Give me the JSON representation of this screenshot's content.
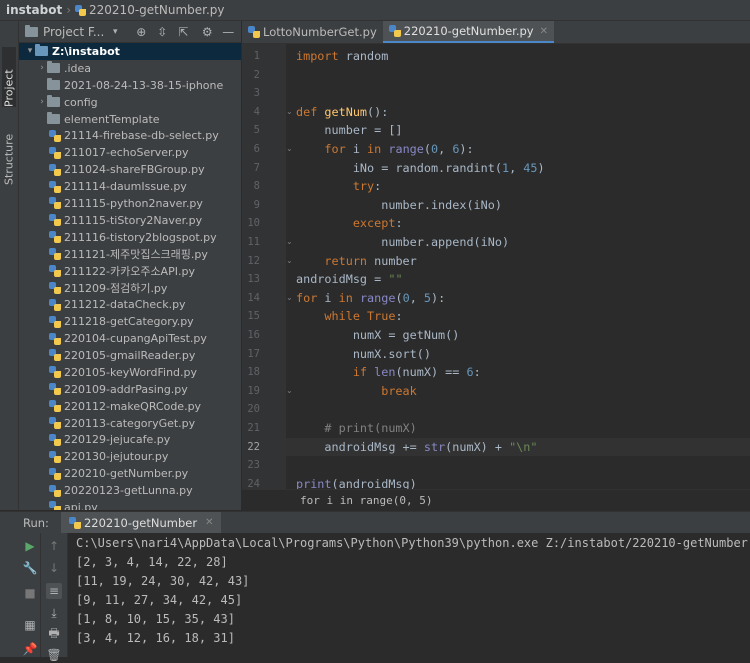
{
  "titlebar": {
    "project": "instabot",
    "file": "220210-getNumber.py"
  },
  "tool_windows": {
    "project": "Project",
    "structure": "Structure"
  },
  "project_panel": {
    "header_label": "Project F...",
    "root": "Z:\\instabot",
    "items": [
      {
        "name": ".idea",
        "type": "folder",
        "expandable": true
      },
      {
        "name": "2021-08-24-13-38-15-iphone",
        "type": "folder",
        "expandable": false
      },
      {
        "name": "config",
        "type": "folder",
        "expandable": true
      },
      {
        "name": "elementTemplate",
        "type": "folder",
        "expandable": false
      },
      {
        "name": "21114-firebase-db-select.py",
        "type": "py"
      },
      {
        "name": "211017-echoServer.py",
        "type": "py"
      },
      {
        "name": "211024-shareFBGroup.py",
        "type": "py"
      },
      {
        "name": "211114-daumIssue.py",
        "type": "py"
      },
      {
        "name": "211115-python2naver.py",
        "type": "py"
      },
      {
        "name": "211115-tiStory2Naver.py",
        "type": "py"
      },
      {
        "name": "211116-tistory2blogspot.py",
        "type": "py"
      },
      {
        "name": "211121-제주맛집스크래핑.py",
        "type": "py"
      },
      {
        "name": "211122-카카오주소API.py",
        "type": "py"
      },
      {
        "name": "211209-점검하기.py",
        "type": "py"
      },
      {
        "name": "211212-dataCheck.py",
        "type": "py"
      },
      {
        "name": "211218-getCategory.py",
        "type": "py"
      },
      {
        "name": "220104-cupangApiTest.py",
        "type": "py"
      },
      {
        "name": "220105-gmailReader.py",
        "type": "py"
      },
      {
        "name": "220105-keyWordFind.py",
        "type": "py"
      },
      {
        "name": "220109-addrPasing.py",
        "type": "py"
      },
      {
        "name": "220112-makeQRCode.py",
        "type": "py"
      },
      {
        "name": "220113-categoryGet.py",
        "type": "py"
      },
      {
        "name": "220129-jejucafe.py",
        "type": "py"
      },
      {
        "name": "220130-jejutour.py",
        "type": "py"
      },
      {
        "name": "220210-getNumber.py",
        "type": "py"
      },
      {
        "name": "20220123-getLunna.py",
        "type": "py"
      },
      {
        "name": "api.py",
        "type": "py"
      }
    ]
  },
  "editor": {
    "tabs": [
      {
        "label": "LottoNumberGet.py",
        "active": false
      },
      {
        "label": "220210-getNumber.py",
        "active": true
      }
    ],
    "current_line": 22,
    "lines": [
      {
        "n": 1,
        "tokens": [
          [
            "kw",
            "import"
          ],
          [
            "p",
            " random"
          ]
        ]
      },
      {
        "n": 2,
        "tokens": []
      },
      {
        "n": 3,
        "tokens": []
      },
      {
        "n": 4,
        "tokens": [
          [
            "kw",
            "def "
          ],
          [
            "fn",
            "getNum"
          ],
          [
            "p",
            "():"
          ]
        ]
      },
      {
        "n": 5,
        "tokens": [
          [
            "p",
            "    number = []"
          ]
        ]
      },
      {
        "n": 6,
        "tokens": [
          [
            "kw",
            "    for "
          ],
          [
            "p",
            "i "
          ],
          [
            "kw",
            "in "
          ],
          [
            "bi",
            "range"
          ],
          [
            "p",
            "("
          ],
          [
            "num",
            "0"
          ],
          [
            "p",
            ", "
          ],
          [
            "num",
            "6"
          ],
          [
            "p",
            "):"
          ]
        ]
      },
      {
        "n": 7,
        "tokens": [
          [
            "p",
            "        iNo = random.randint("
          ],
          [
            "num",
            "1"
          ],
          [
            "p",
            ", "
          ],
          [
            "num",
            "45"
          ],
          [
            "p",
            ")"
          ]
        ]
      },
      {
        "n": 8,
        "tokens": [
          [
            "kw",
            "        try"
          ],
          [
            "p",
            ":"
          ]
        ]
      },
      {
        "n": 9,
        "tokens": [
          [
            "p",
            "            number.index(iNo)"
          ]
        ]
      },
      {
        "n": 10,
        "tokens": [
          [
            "kw",
            "        except"
          ],
          [
            "p",
            ":"
          ]
        ]
      },
      {
        "n": 11,
        "tokens": [
          [
            "p",
            "            number.append(iNo)"
          ]
        ]
      },
      {
        "n": 12,
        "tokens": [
          [
            "kw",
            "    return "
          ],
          [
            "p",
            "number"
          ]
        ]
      },
      {
        "n": 13,
        "tokens": [
          [
            "p",
            "androidMsg = "
          ],
          [
            "str",
            "\"\""
          ]
        ]
      },
      {
        "n": 14,
        "tokens": [
          [
            "kw",
            "for "
          ],
          [
            "p",
            "i "
          ],
          [
            "kw",
            "in "
          ],
          [
            "bi",
            "range"
          ],
          [
            "p",
            "("
          ],
          [
            "num",
            "0"
          ],
          [
            "p",
            ", "
          ],
          [
            "num",
            "5"
          ],
          [
            "p",
            "):"
          ]
        ]
      },
      {
        "n": 15,
        "tokens": [
          [
            "kw",
            "    while True"
          ],
          [
            "p",
            ":"
          ]
        ]
      },
      {
        "n": 16,
        "tokens": [
          [
            "p",
            "        numX = getNum()"
          ]
        ]
      },
      {
        "n": 17,
        "tokens": [
          [
            "p",
            "        numX.sort()"
          ]
        ]
      },
      {
        "n": 18,
        "tokens": [
          [
            "kw",
            "        if "
          ],
          [
            "bi",
            "len"
          ],
          [
            "p",
            "(numX) == "
          ],
          [
            "num",
            "6"
          ],
          [
            "p",
            ":"
          ]
        ]
      },
      {
        "n": 19,
        "tokens": [
          [
            "kw",
            "            break"
          ]
        ]
      },
      {
        "n": 20,
        "tokens": []
      },
      {
        "n": 21,
        "tokens": [
          [
            "cm",
            "    # print(numX)"
          ]
        ]
      },
      {
        "n": 22,
        "tokens": [
          [
            "p",
            "    androidMsg += "
          ],
          [
            "bi",
            "str"
          ],
          [
            "p",
            "(numX) + "
          ],
          [
            "str",
            "\"\\n\""
          ]
        ]
      },
      {
        "n": 23,
        "tokens": []
      },
      {
        "n": 24,
        "tokens": [
          [
            "bi",
            "print"
          ],
          [
            "p",
            "(androidMsg)"
          ]
        ]
      }
    ],
    "breadcrumb": "for i in range(0, 5)"
  },
  "run": {
    "label": "Run:",
    "tab": "220210-getNumber",
    "output": [
      "C:\\Users\\nari4\\AppData\\Local\\Programs\\Python\\Python39\\python.exe Z:/instabot/220210-getNumber.py",
      "[2, 3, 4, 14, 22, 28]",
      "[11, 19, 24, 30, 42, 43]",
      "[9, 11, 27, 34, 42, 45]",
      "[1, 8, 10, 15, 35, 43]",
      "[3, 4, 12, 16, 18, 31]"
    ]
  }
}
